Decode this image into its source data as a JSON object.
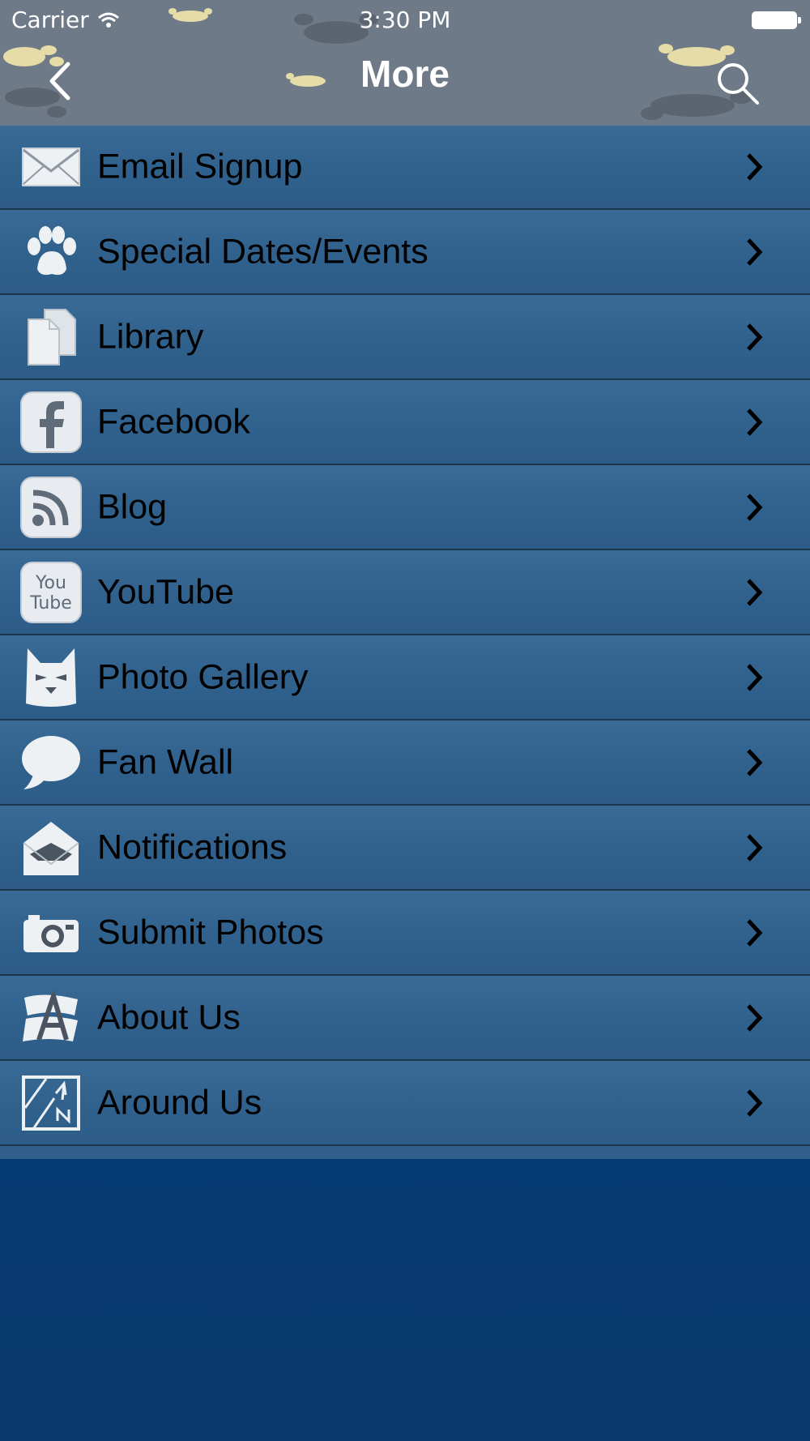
{
  "status_bar": {
    "carrier": "Carrier",
    "time": "3:30 PM"
  },
  "nav": {
    "title": "More",
    "back_icon": "chevron-left-icon",
    "search_icon": "search-icon"
  },
  "colors": {
    "header": "#6e7a87",
    "menu_row": "#30618d",
    "row_divider": "#1c3650",
    "lower_background": "#063a72",
    "paw_light": "#e6dca8",
    "paw_dark": "#5c6470"
  },
  "menu": {
    "items": [
      {
        "label": "Email Signup",
        "icon": "envelope-icon"
      },
      {
        "label": "Special Dates/Events",
        "icon": "paw-icon"
      },
      {
        "label": "Library",
        "icon": "documents-icon"
      },
      {
        "label": "Facebook",
        "icon": "facebook-icon"
      },
      {
        "label": "Blog",
        "icon": "rss-icon"
      },
      {
        "label": "YouTube",
        "icon": "youtube-icon",
        "icon_text_top": "You",
        "icon_text_bottom": "Tube"
      },
      {
        "label": "Photo Gallery",
        "icon": "cat-icon"
      },
      {
        "label": "Fan Wall",
        "icon": "speech-bubble-icon"
      },
      {
        "label": "Notifications",
        "icon": "open-envelope-icon"
      },
      {
        "label": "Submit Photos",
        "icon": "camera-icon"
      },
      {
        "label": "About Us",
        "icon": "about-icon"
      },
      {
        "label": "Around Us",
        "icon": "map-icon"
      }
    ]
  }
}
